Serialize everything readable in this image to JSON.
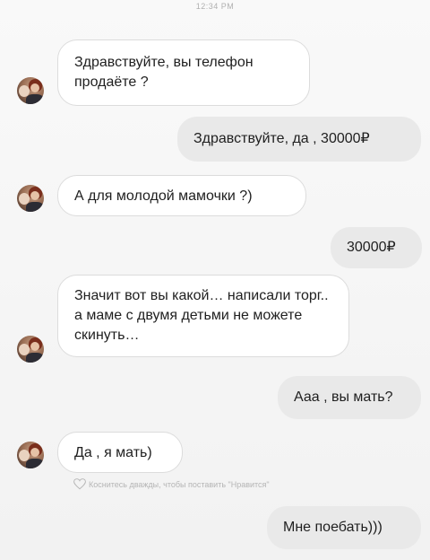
{
  "status_time": "12:34 PM",
  "messages": [
    {
      "from": "them",
      "text": "Здравствуйте, вы телефон продаёте ?"
    },
    {
      "from": "me",
      "text": "Здравствуйте, да , 30000₽"
    },
    {
      "from": "them",
      "text": "А для молодой мамочки ?)"
    },
    {
      "from": "me",
      "text": "30000₽"
    },
    {
      "from": "them",
      "text": "Значит вот вы какой… написали торг.. а маме с двумя детьми не можете скинуть…"
    },
    {
      "from": "me",
      "text": "Ааа , вы мать?"
    },
    {
      "from": "them",
      "text": "Да , я мать)"
    },
    {
      "from": "me",
      "text": "Мне поебать)))"
    }
  ],
  "like_hint": "Коснитесь дважды, чтобы поставить \"Нравится\"",
  "icons": {
    "avatar": "avatar",
    "like": "heart-outline-icon"
  },
  "colors": {
    "incoming_bubble": "#ffffff",
    "outgoing_bubble": "#e9e9e9",
    "text": "#1f1f1f",
    "hint": "#b5b5b5"
  }
}
